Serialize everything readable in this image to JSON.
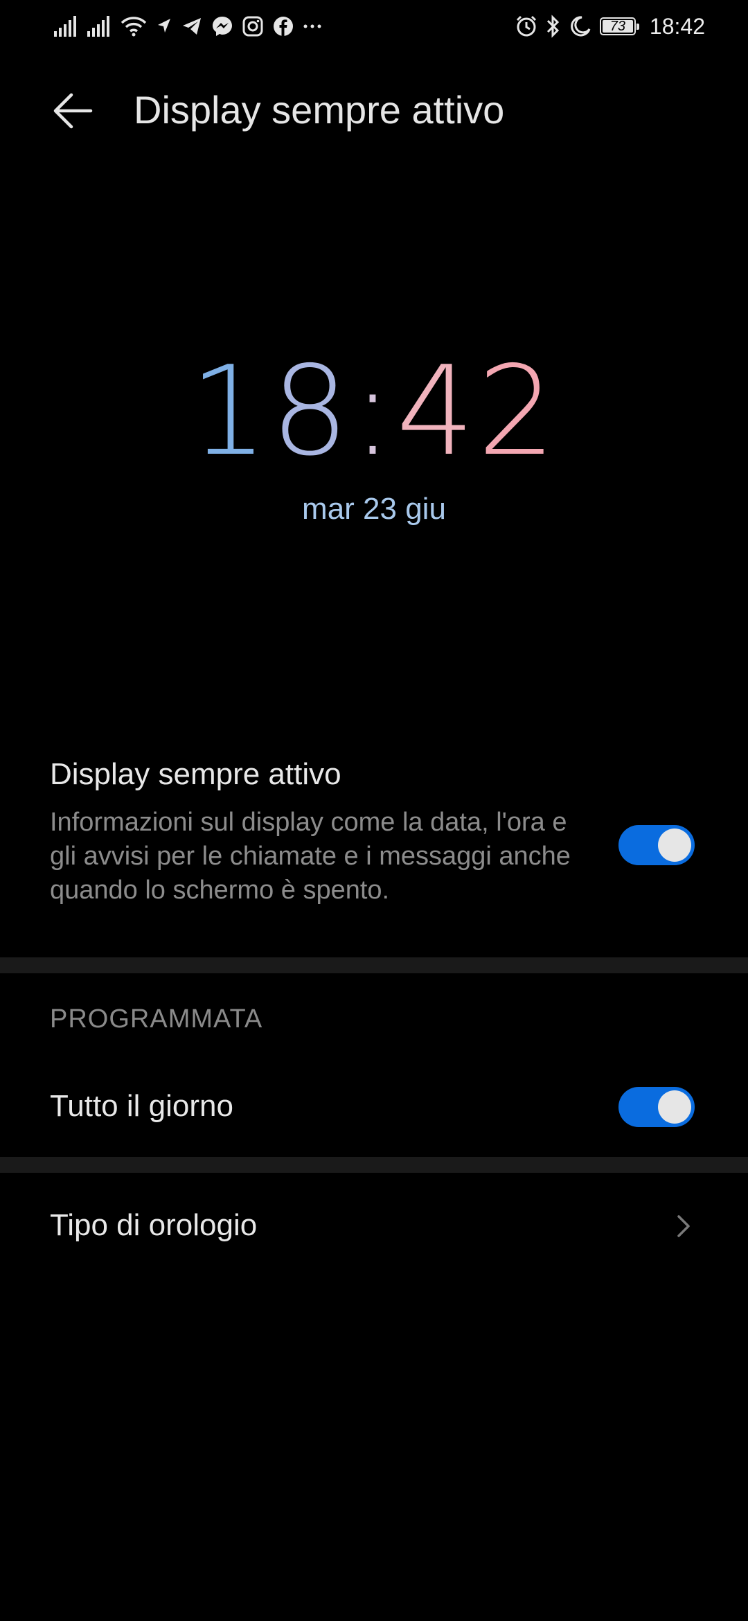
{
  "status_bar": {
    "time": "18:42",
    "battery_level": "73",
    "left_icons": [
      "signal-icon",
      "signal-icon-2",
      "wifi-icon",
      "location-icon",
      "telegram-icon",
      "messenger-icon",
      "instagram-icon",
      "facebook-icon",
      "more-icon"
    ],
    "right_icons": [
      "alarm-icon",
      "bluetooth-icon",
      "moon-icon",
      "battery-icon"
    ]
  },
  "header": {
    "title": "Display sempre attivo",
    "back_icon": "arrow-left-icon"
  },
  "preview": {
    "time_digits": [
      "1",
      "8",
      ":",
      "4",
      "2"
    ],
    "date": "mar 23 giu",
    "digit_colors": [
      "#7fb0e6",
      "#a9b6e2",
      "#d6c4dc",
      "#f1b3bd",
      "#f4a7b2"
    ],
    "date_color": "#a9c9ec"
  },
  "aod_setting": {
    "title": "Display sempre attivo",
    "description": "Informazioni sul display come la data, l'ora e gli avvisi per le chiamate e i messaggi anche quando lo schermo è spento.",
    "enabled": true
  },
  "schedule": {
    "section_title": "PROGRAMMATA",
    "all_day_label": "Tutto il giorno",
    "all_day_enabled": true
  },
  "clock_type": {
    "label": "Tipo di orologio",
    "icon": "chevron-right-icon"
  },
  "colors": {
    "background": "#000000",
    "accent": "#0a6cdf",
    "divider": "#1a1a1a",
    "secondary_text": "#8c8c8c"
  }
}
